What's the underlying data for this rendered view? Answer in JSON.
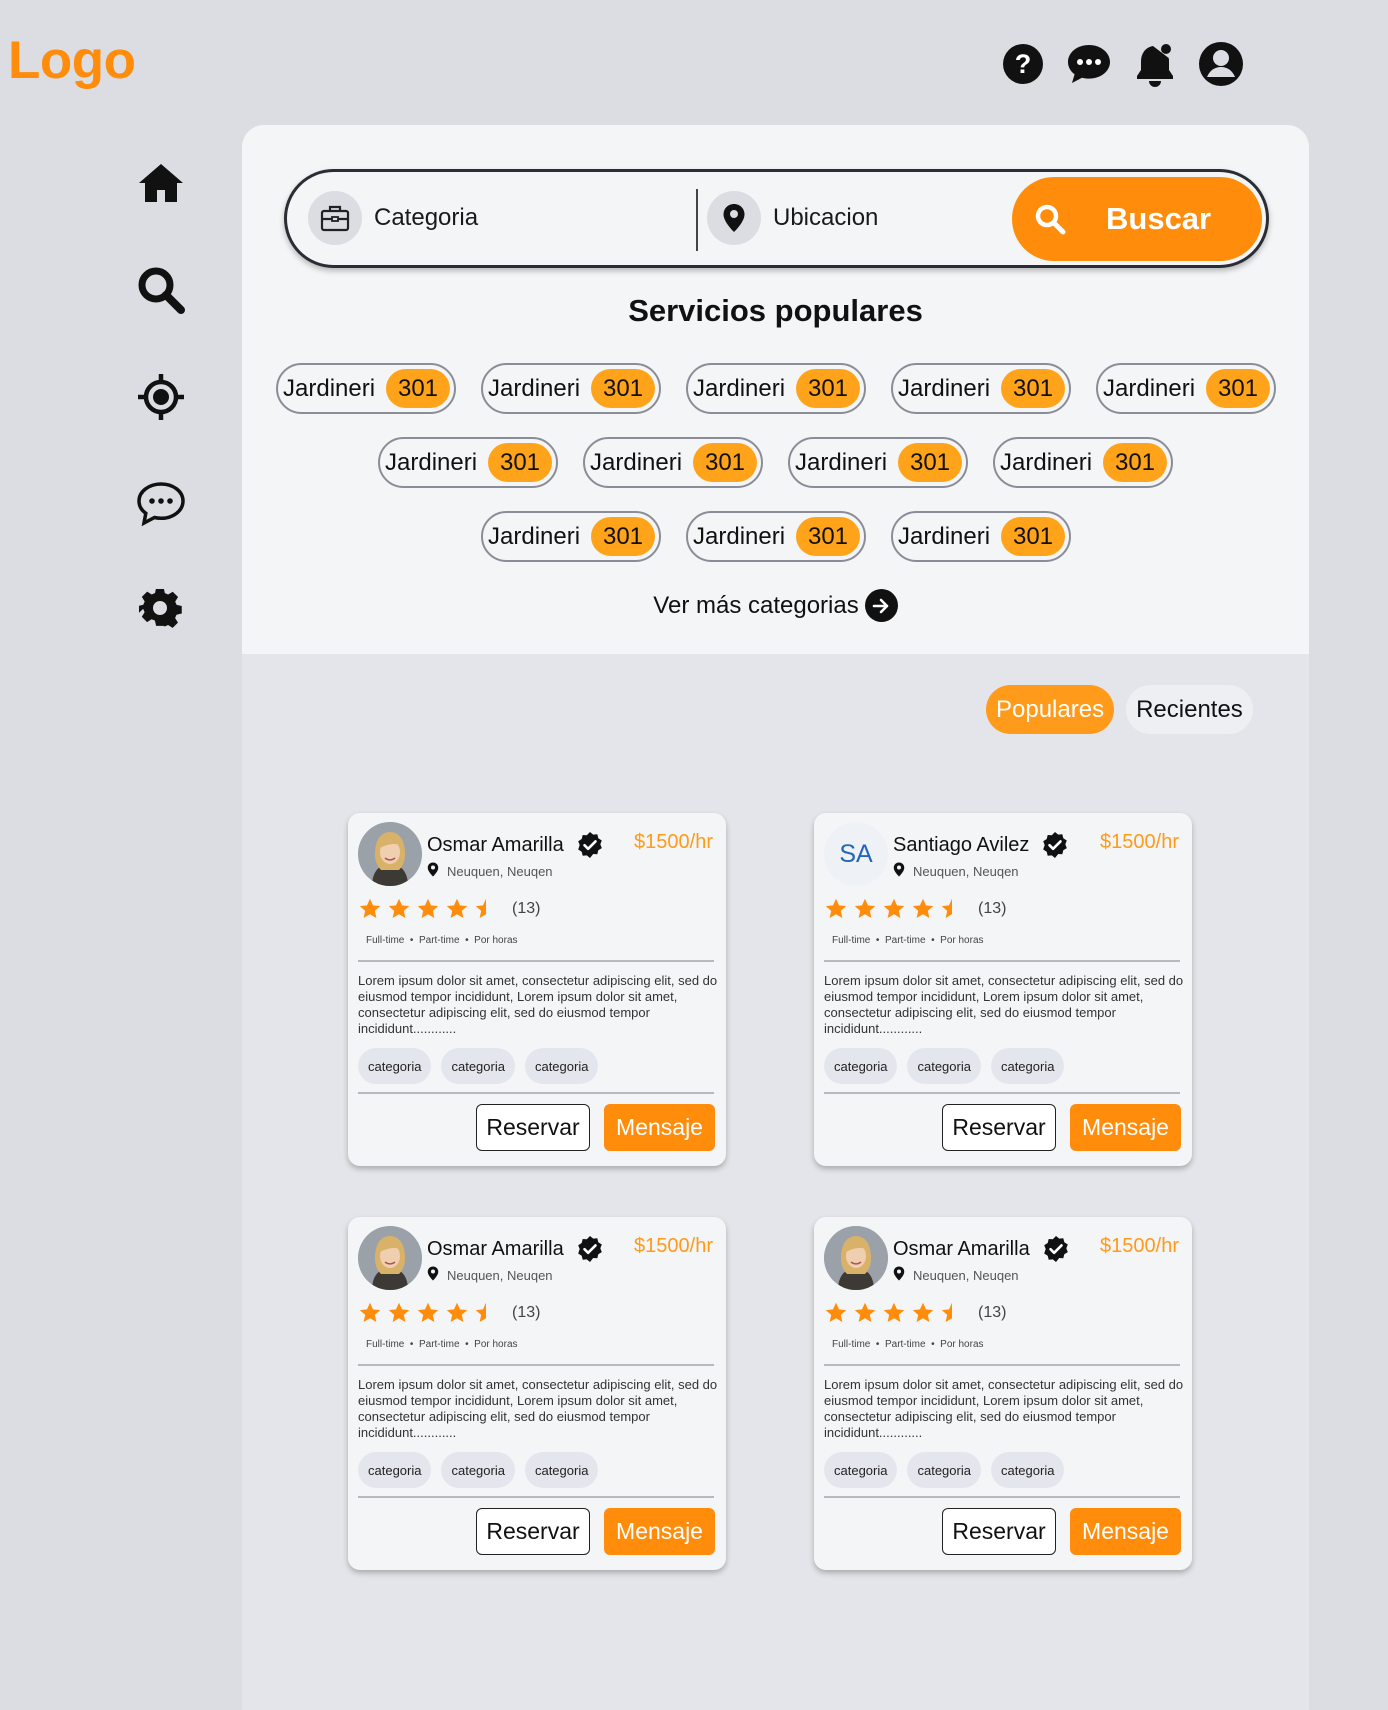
{
  "logo": "Logo",
  "top_icons": [
    "help-icon",
    "chat-icon",
    "notification-bell-icon",
    "profile-icon"
  ],
  "sidebar": [
    "home-icon",
    "search-icon",
    "location-target-icon",
    "chat-icon",
    "settings-gear-icon"
  ],
  "search": {
    "category_label": "Categoria",
    "location_label": "Ubicacion",
    "button_label": "Buscar"
  },
  "popular_services": {
    "title": "Servicios populares",
    "chips": [
      {
        "name": "Jardineri",
        "count": "301"
      },
      {
        "name": "Jardineri",
        "count": "301"
      },
      {
        "name": "Jardineri",
        "count": "301"
      },
      {
        "name": "Jardineri",
        "count": "301"
      },
      {
        "name": "Jardineri",
        "count": "301"
      },
      {
        "name": "Jardineri",
        "count": "301"
      },
      {
        "name": "Jardineri",
        "count": "301"
      },
      {
        "name": "Jardineri",
        "count": "301"
      },
      {
        "name": "Jardineri",
        "count": "301"
      },
      {
        "name": "Jardineri",
        "count": "301"
      },
      {
        "name": "Jardineri",
        "count": "301"
      },
      {
        "name": "Jardineri",
        "count": "301"
      }
    ],
    "see_more": "Ver más categorias"
  },
  "tabs": {
    "active": "Populares",
    "inactive": "Recientes"
  },
  "colors": {
    "accent": "#ff8c0a",
    "background": "#dcdde2",
    "panel": "#f4f5f7"
  },
  "cards": [
    {
      "name": "Osmar Amarilla",
      "avatar": "photo",
      "initials": "",
      "price": "$1500/hr",
      "location": "Neuquen, Neuqen",
      "rating": 4.5,
      "reviews": "(13)",
      "tags": [
        "Full-time",
        "Part-time",
        "Por horas"
      ],
      "description": "Lorem ipsum dolor sit amet, consectetur adipiscing elit, sed do eiusmod tempor incididunt, Lorem ipsum dolor sit amet, consectetur adipiscing elit, sed do eiusmod tempor incididunt............",
      "categories": [
        "categoria",
        "categoria",
        "categoria"
      ],
      "reserve_label": "Reservar",
      "message_label": "Mensaje"
    },
    {
      "name": "Santiago Avilez",
      "avatar": "initials",
      "initials": "SA",
      "price": "$1500/hr",
      "location": "Neuquen, Neuqen",
      "rating": 4.5,
      "reviews": "(13)",
      "tags": [
        "Full-time",
        "Part-time",
        "Por horas"
      ],
      "description": "Lorem ipsum dolor sit amet, consectetur adipiscing elit, sed do eiusmod tempor incididunt, Lorem ipsum dolor sit amet, consectetur adipiscing elit, sed do eiusmod tempor incididunt............",
      "categories": [
        "categoria",
        "categoria",
        "categoria"
      ],
      "reserve_label": "Reservar",
      "message_label": "Mensaje"
    },
    {
      "name": "Osmar Amarilla",
      "avatar": "photo",
      "initials": "",
      "price": "$1500/hr",
      "location": "Neuquen, Neuqen",
      "rating": 4.5,
      "reviews": "(13)",
      "tags": [
        "Full-time",
        "Part-time",
        "Por horas"
      ],
      "description": "Lorem ipsum dolor sit amet, consectetur adipiscing elit, sed do eiusmod tempor incididunt, Lorem ipsum dolor sit amet, consectetur adipiscing elit, sed do eiusmod tempor incididunt............",
      "categories": [
        "categoria",
        "categoria",
        "categoria"
      ],
      "reserve_label": "Reservar",
      "message_label": "Mensaje"
    },
    {
      "name": "Osmar Amarilla",
      "avatar": "photo",
      "initials": "",
      "price": "$1500/hr",
      "location": "Neuquen, Neuqen",
      "rating": 4.5,
      "reviews": "(13)",
      "tags": [
        "Full-time",
        "Part-time",
        "Por horas"
      ],
      "description": "Lorem ipsum dolor sit amet, consectetur adipiscing elit, sed do eiusmod tempor incididunt, Lorem ipsum dolor sit amet, consectetur adipiscing elit, sed do eiusmod tempor incididunt............",
      "categories": [
        "categoria",
        "categoria",
        "categoria"
      ],
      "reserve_label": "Reservar",
      "message_label": "Mensaje"
    }
  ]
}
